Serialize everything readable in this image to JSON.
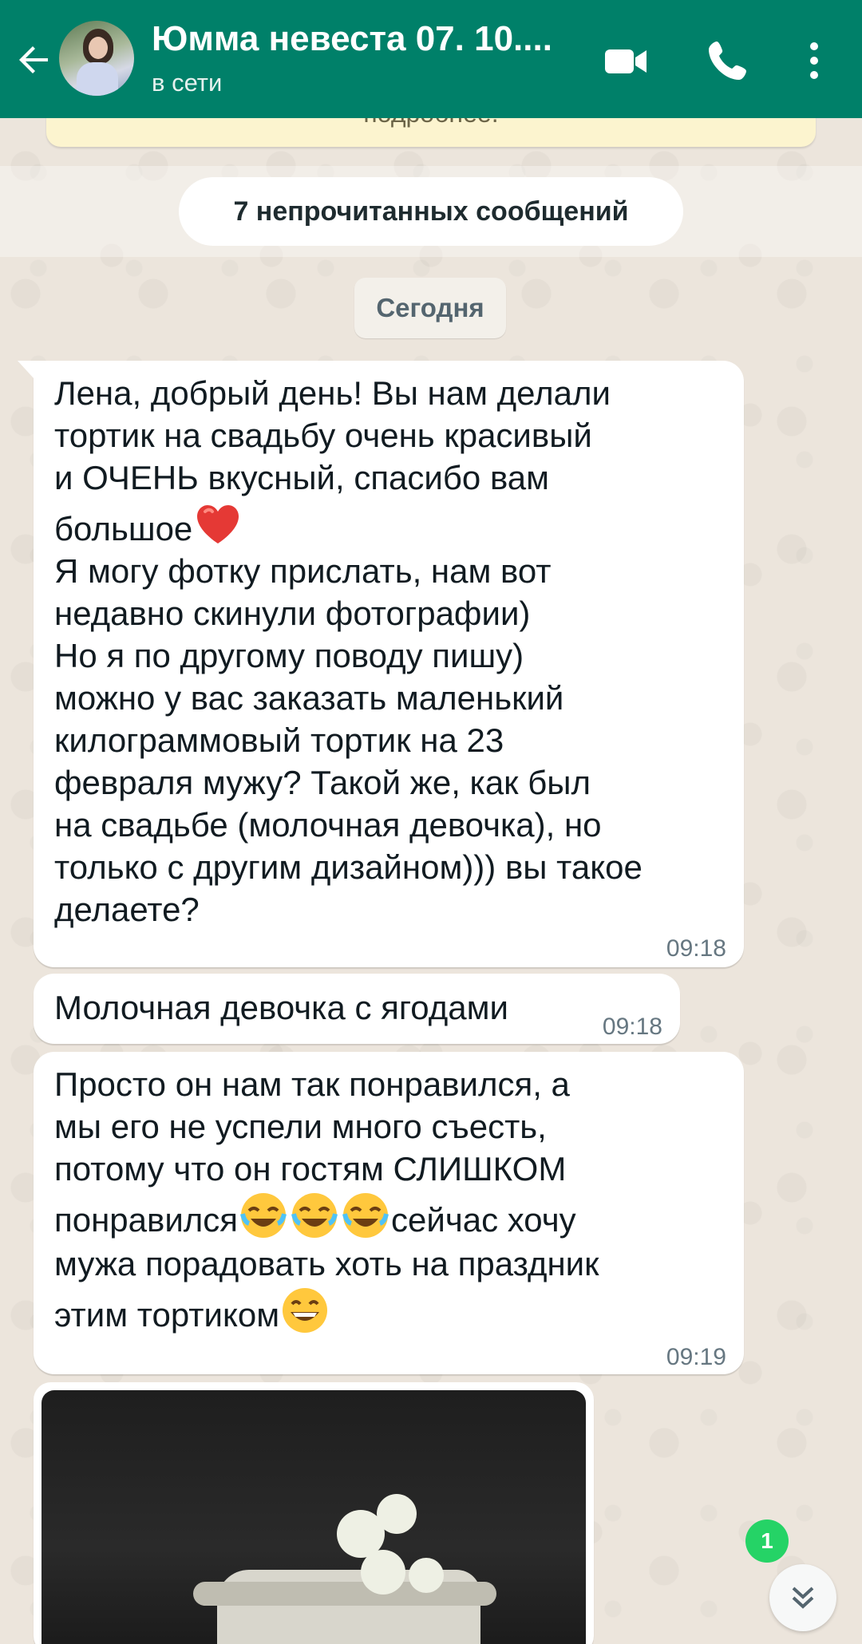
{
  "header": {
    "contact_name": "Юмма невеста 07. 10....",
    "status": "в сети",
    "colors": {
      "bar": "#008069",
      "text": "#ffffff"
    },
    "icons": [
      "back-arrow-icon",
      "video-call-icon",
      "phone-call-icon",
      "more-options-icon"
    ]
  },
  "info_banner": {
    "text": "подробнее."
  },
  "unread_divider": {
    "label": "7 непрочитанных сообщений"
  },
  "date_divider": {
    "label": "Сегодня"
  },
  "messages": [
    {
      "text_before_emoji": "Лена, добрый день! Вы нам делали\nтортик на свадьбу очень красивый\nи ОЧЕНЬ вкусный, спасибо вам\nбольшое",
      "emoji": "red-heart",
      "text_after_emoji": "Я могу фотку прислать, нам вот\nнедавно скинули фотографии)\nНо я по другому поводу пишу)\nможно у вас заказать маленький\nкилограммовый тортик на 23\nфевраля мужу? Такой же, как был\nна свадьбе (молочная девочка), но\nтолько с другим дизайном))) вы такое\nделаете?",
      "time": "09:18"
    },
    {
      "text": "Молочная девочка с ягодами",
      "time": "09:18"
    },
    {
      "line1": "Просто он нам так понравился, а",
      "line2": "мы его не успели много съесть,",
      "line3": "потому что он гостям СЛИШКОМ",
      "line4_start": "понравился",
      "line4_emoji": "face-with-tears-of-joy",
      "line4_end": "сейчас хочу",
      "line5": "мужа порадовать хоть на праздник",
      "line6_start": "этим тортиком",
      "line6_emoji": "grinning-face",
      "time": "09:19"
    }
  ],
  "photo_message": {
    "content": "wedding-cake-photo"
  },
  "scroll_badge": {
    "count": "1"
  }
}
